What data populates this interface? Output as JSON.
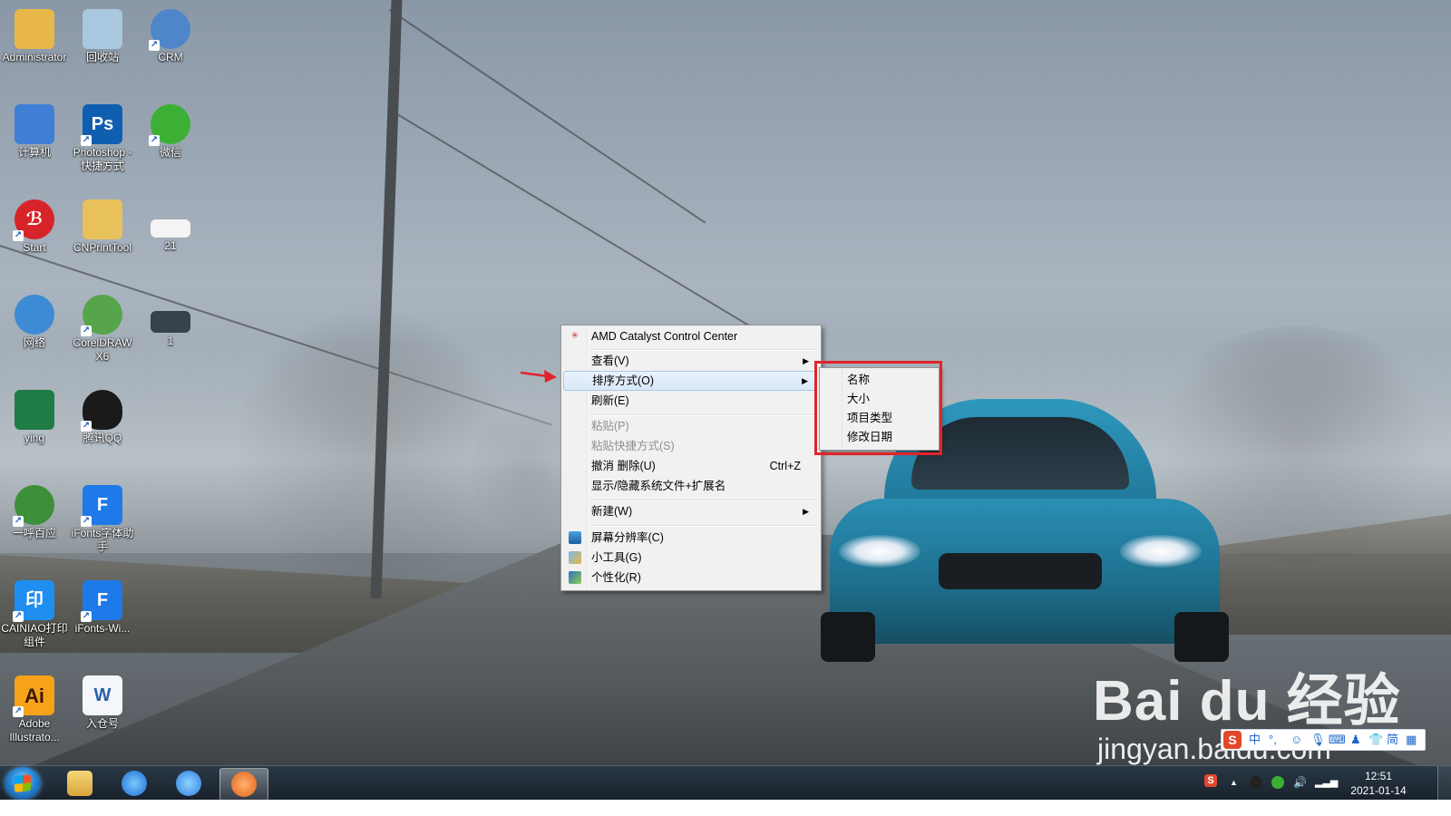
{
  "desktop": {
    "icons": [
      {
        "label": "Administrator",
        "icon": "user-folder-icon",
        "color": "#e8b84a"
      },
      {
        "label": "回收站",
        "icon": "recycle-bin-icon",
        "color": "#a9c7de"
      },
      {
        "label": "CRM",
        "icon": "globe-icon",
        "color": "#4e86c9"
      },
      {
        "label": "计算机",
        "icon": "computer-icon",
        "color": "#3f7fd6"
      },
      {
        "label": "Photoshop - 快捷方式",
        "icon": "photoshop-icon",
        "glyph": "Ps",
        "color": "#0f5fb1"
      },
      {
        "label": "微信",
        "icon": "wechat-icon",
        "color": "#3cb034"
      },
      {
        "label": "Start",
        "icon": "start-app-icon",
        "glyph": "ℬ",
        "color": "#d7242a"
      },
      {
        "label": "CNPrintTool",
        "icon": "folder-icon",
        "color": "#e9c15a"
      },
      {
        "label": "21",
        "icon": "image-file-icon",
        "color": "#f4f4f4"
      },
      {
        "label": "网络",
        "icon": "network-icon",
        "color": "#3c8bd4"
      },
      {
        "label": "CorelDRAW X6",
        "icon": "coreldraw-icon",
        "color": "#56a54b"
      },
      {
        "label": "1",
        "icon": "photo-file-icon",
        "color": "#37424d"
      },
      {
        "label": "ying",
        "icon": "excel-file-icon",
        "color": "#1f7c45"
      },
      {
        "label": "腾讯QQ",
        "icon": "qq-penguin-icon",
        "color": "#1a1a1a"
      },
      {
        "label": "一呼百应",
        "icon": "globe-icon",
        "color": "#3e8f3a"
      },
      {
        "label": "iFonts字体助手",
        "icon": "ifonts-icon",
        "glyph": "F",
        "color": "#1d7ae8"
      },
      {
        "label": "CAINIAO打印组件",
        "icon": "cainiao-print-icon",
        "glyph": "印",
        "color": "#1e8ef0"
      },
      {
        "label": "iFonts-Wi...",
        "icon": "ifonts-icon",
        "glyph": "F",
        "color": "#1d7ae8"
      },
      {
        "label": "Adobe Illustrato...",
        "icon": "illustrator-icon",
        "glyph": "Ai",
        "color": "#f7a21b"
      },
      {
        "label": "入仓号",
        "icon": "word-file-icon",
        "glyph": "W",
        "color": "#2c5fa8"
      }
    ]
  },
  "context_menu": {
    "amd": "AMD Catalyst Control Center",
    "view": "查看(V)",
    "sort": "排序方式(O)",
    "refresh": "刷新(E)",
    "paste": "粘贴(P)",
    "paste_shortcut": "粘贴快捷方式(S)",
    "undo_delete": "撤消 删除(U)",
    "undo_shortcut": "Ctrl+Z",
    "toggle_hidden": "显示/隐藏系统文件+扩展名",
    "new": "新建(W)",
    "resolution": "屏幕分辨率(C)",
    "gadgets": "小工具(G)",
    "personalize": "个性化(R)"
  },
  "sort_submenu": {
    "name": "名称",
    "size": "大小",
    "type": "项目类型",
    "date": "修改日期"
  },
  "ime_bar": {
    "logo": "S",
    "mode": "中",
    "simplified": "简"
  },
  "taskbar": {
    "time": "12:51",
    "date": "2021-01-14",
    "sogou": "S"
  },
  "watermark": {
    "brand": "Bai du 经验",
    "url": "jingyan.baidu.com"
  },
  "colors": {
    "highlight_box": "#e3232a",
    "menu_bg": "#f1f1f1"
  }
}
